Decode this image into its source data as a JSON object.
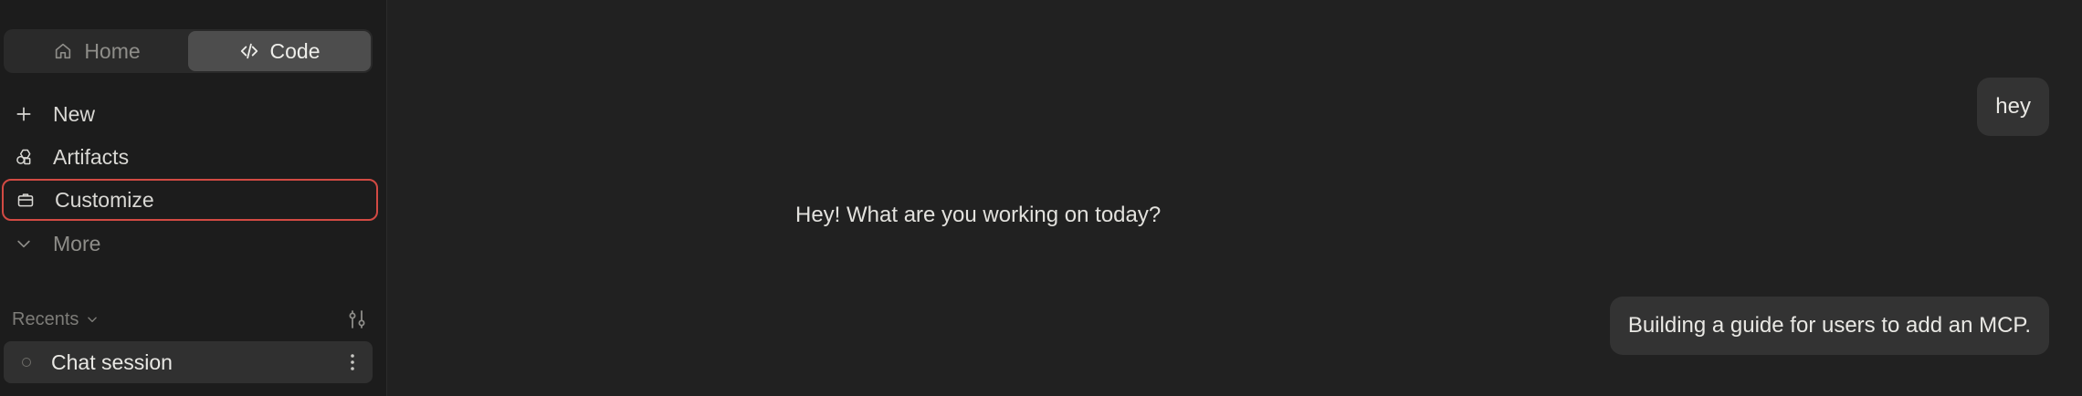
{
  "sidebar": {
    "mode_toggle": {
      "home_label": "Home",
      "code_label": "Code",
      "active": "code"
    },
    "nav": {
      "new_label": "New",
      "artifacts_label": "Artifacts",
      "customize_label": "Customize",
      "more_label": "More"
    },
    "recents": {
      "label": "Recents",
      "sessions": [
        {
          "title": "Chat session"
        }
      ]
    }
  },
  "chat": {
    "messages": [
      {
        "role": "user",
        "text": "hey"
      },
      {
        "role": "assistant",
        "text": "Hey! What are you working on today?"
      },
      {
        "role": "user",
        "text": "Building a guide for users to add an MCP."
      }
    ]
  },
  "colors": {
    "highlight_outline": "#d24a43",
    "sidebar_bg": "#1c1c1c",
    "main_bg": "#212121"
  }
}
